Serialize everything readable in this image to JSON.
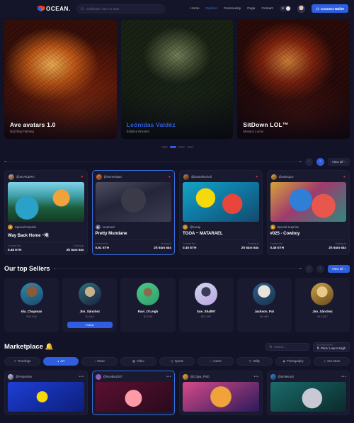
{
  "navbar": {
    "logo_text": "OCEAN.",
    "logo_icon": "cube-icon",
    "search": {
      "placeholder": "Collection, item or user",
      "value": "",
      "icon": "search-icon"
    },
    "links": [
      {
        "label": "Home",
        "active": false
      },
      {
        "label": "Explore",
        "active": true
      },
      {
        "label": "Community",
        "active": false
      },
      {
        "label": "Page",
        "active": false
      },
      {
        "label": "Contact",
        "active": false
      }
    ],
    "theme_toggle": {
      "icon": "moon-icon",
      "state": "dark"
    },
    "avatar": "user-avatar",
    "wallet_button": {
      "label": "Connect Wallet",
      "icon": "wallet-icon",
      "color": "#2f5fe0"
    }
  },
  "hero": {
    "slides": [
      {
        "title": "Ave avatars 1.0",
        "subtitle": "Dazzling Flaming",
        "highlight": false
      },
      {
        "title": "Leónidas Valdéz",
        "subtitle": "Solstice Dreams",
        "highlight": true
      },
      {
        "title": "SitDown LOL™",
        "subtitle": "Monaco Lucas",
        "highlight": false
      }
    ],
    "pagination": {
      "count": 4,
      "active_index": 1
    }
  },
  "live_auctions": {
    "title": "",
    "prev_label": "‹",
    "next_label": "›",
    "view_all_label": "View all",
    "view_all_icon": "arrow-right-icon",
    "cards": [
      {
        "user": "@SHAILERA",
        "badge": "Special Surprise",
        "name": "Way Back Home ~地",
        "bid_label": "Current bid",
        "bid_value": "0.48 ETH",
        "ending_label": "Ending in",
        "ending_value": "2h  54m  54s",
        "liked": true,
        "selected": false
      },
      {
        "user": "@Honerisant",
        "badge": "Amanawl",
        "name": "Pretty Mundane",
        "bid_label": "Current bid",
        "bid_value": "0.91 ETH",
        "ending_label": "Ending in",
        "ending_value": "2h  54m  54s",
        "liked": true,
        "selected": true
      },
      {
        "user": "@Daniellecholl",
        "badge": "@kunaji",
        "name": "TGOA ~ MATARAEL",
        "bid_label": "Current bid",
        "bid_value": "0.40 ETH",
        "ending_label": "Ending in",
        "ending_value": "2h  54m  54s",
        "liked": true,
        "selected": false
      },
      {
        "user": "@wintspce",
        "badge": "Special Surprise",
        "name": "#025 - Cowboy",
        "bid_label": "Current bid",
        "bid_value": "0.46 ETH",
        "ending_label": "Ending in",
        "ending_value": "2h  54m  54s",
        "liked": true,
        "selected": false
      }
    ]
  },
  "top_sellers": {
    "title": "Our top Sellers",
    "prev_label": "‹",
    "next_label": "›",
    "view_all_label": "View all",
    "sellers": [
      {
        "name": "Ida_Chapman",
        "amount": "$30,453",
        "follow": null
      },
      {
        "name": "Jim_Sánchez",
        "amount": "$1,044",
        "follow": "Follow"
      },
      {
        "name": "Ravi_O'Leigh",
        "amount": "$2,000",
        "follow": null
      },
      {
        "name": "Sue_Shall97",
        "amount": "$12,067",
        "follow": null
      },
      {
        "name": "Jackson_Pat",
        "amount": "$6,493",
        "follow": null
      },
      {
        "name": "Jim_Sánchez",
        "amount": "$12,067",
        "follow": null
      }
    ]
  },
  "marketplace": {
    "title": "Marketplace 🔔",
    "search": {
      "placeholder": "Search...",
      "value": "",
      "icon": "search-icon"
    },
    "sort": {
      "label": "FILTERS SORT",
      "value": "Price: Low to High",
      "icon": "sort-icon"
    },
    "chips": [
      {
        "label": "Trendings",
        "icon": "fire-icon",
        "active": false
      },
      {
        "label": "Art",
        "icon": "palette-icon",
        "active": true
      },
      {
        "label": "Music",
        "icon": "music-icon",
        "active": false
      },
      {
        "label": "Video",
        "icon": "video-icon",
        "active": false
      },
      {
        "label": "Sports",
        "icon": "sports-icon",
        "active": false
      },
      {
        "label": "Game",
        "icon": "game-icon",
        "active": false
      },
      {
        "label": "Utility",
        "icon": "utility-icon",
        "active": false
      },
      {
        "label": "Photography",
        "icon": "camera-icon",
        "active": false
      },
      {
        "label": "See More",
        "icon": "more-icon",
        "active": false
      }
    ],
    "cards": [
      {
        "user": "@Hopantan",
        "menu": "•••",
        "selected": false
      },
      {
        "user": "@Nootka1007",
        "menu": "•••",
        "selected": true
      },
      {
        "user": "@Colya_FND",
        "menu": "•••",
        "selected": false
      },
      {
        "user": "@amletural",
        "menu": "•••",
        "selected": false
      }
    ]
  }
}
